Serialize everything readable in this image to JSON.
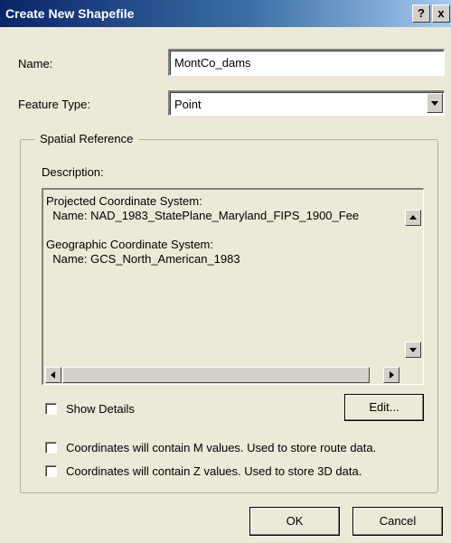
{
  "window": {
    "title": "Create New Shapefile",
    "help_button": "?",
    "close_button": "x"
  },
  "name_field": {
    "label": "Name:",
    "value": "MontCo_dams"
  },
  "feature_type": {
    "label": "Feature Type:",
    "selected": "Point"
  },
  "spatial_reference": {
    "group_label": "Spatial Reference",
    "description_label": "Description:",
    "description_text": "Projected Coordinate System:\n  Name: NAD_1983_StatePlane_Maryland_FIPS_1900_Fee\n\nGeographic Coordinate System:\n  Name: GCS_North_American_1983",
    "show_details_label": "Show Details",
    "edit_button": "Edit..."
  },
  "options": {
    "m_values_label": "Coordinates will contain M values. Used to store route data.",
    "z_values_label": "Coordinates will contain Z values. Used to store 3D data."
  },
  "footer": {
    "ok_label": "OK",
    "cancel_label": "Cancel"
  }
}
